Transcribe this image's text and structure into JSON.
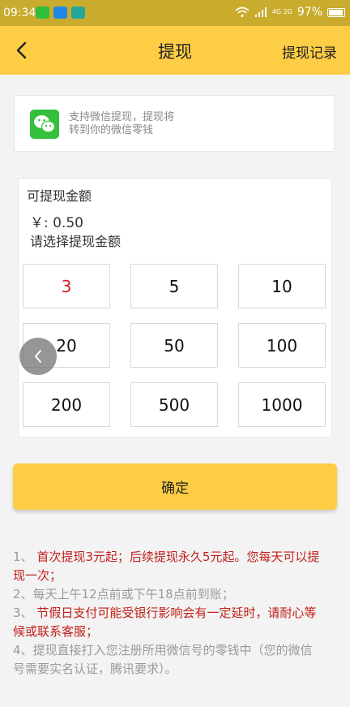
{
  "status_bar": {
    "time": "09:34",
    "network": "4G 2G",
    "battery": "97%",
    "icons": [
      "wechat-icon",
      "message-icon",
      "scan-icon",
      "wifi-icon",
      "signal-icon",
      "battery-icon"
    ]
  },
  "header": {
    "title": "提现",
    "record_label": "提现记录",
    "background": "#fdcd45"
  },
  "wechat_card": {
    "line1": "支持微信提现，提现将",
    "line2": "转到你的微信零钱"
  },
  "amount": {
    "available_label": "可提现金额",
    "balance": "￥: 0.50",
    "choose_label": "请选择提现金额",
    "options": [
      "3",
      "5",
      "10",
      "20",
      "50",
      "100",
      "200",
      "500",
      "1000"
    ],
    "selected": "3"
  },
  "confirm_label": "确定",
  "notes": [
    {
      "num": "1、",
      "text": "首次提现3元起；后续提现永久5元起。您每天可以提现一次；",
      "color": "#c1201a"
    },
    {
      "num": "2、",
      "text": "每天上午12点前或下午18点前到账；",
      "color": "#9a9a9a"
    },
    {
      "num": "3、",
      "text": "节假日支付可能受银行影响会有一定延时，请耐心等候或联系客服；",
      "color": "#c1201a"
    },
    {
      "num": "4、",
      "text": "提现直接打入您注册所用微信号的零钱中（您的微信号需要实名认证，腾讯要求）。",
      "color": "#9a9a9a"
    }
  ],
  "colors": {
    "accent": "#fdcd45",
    "selected_option": "#d0211c",
    "warning_text": "#c1201a"
  }
}
